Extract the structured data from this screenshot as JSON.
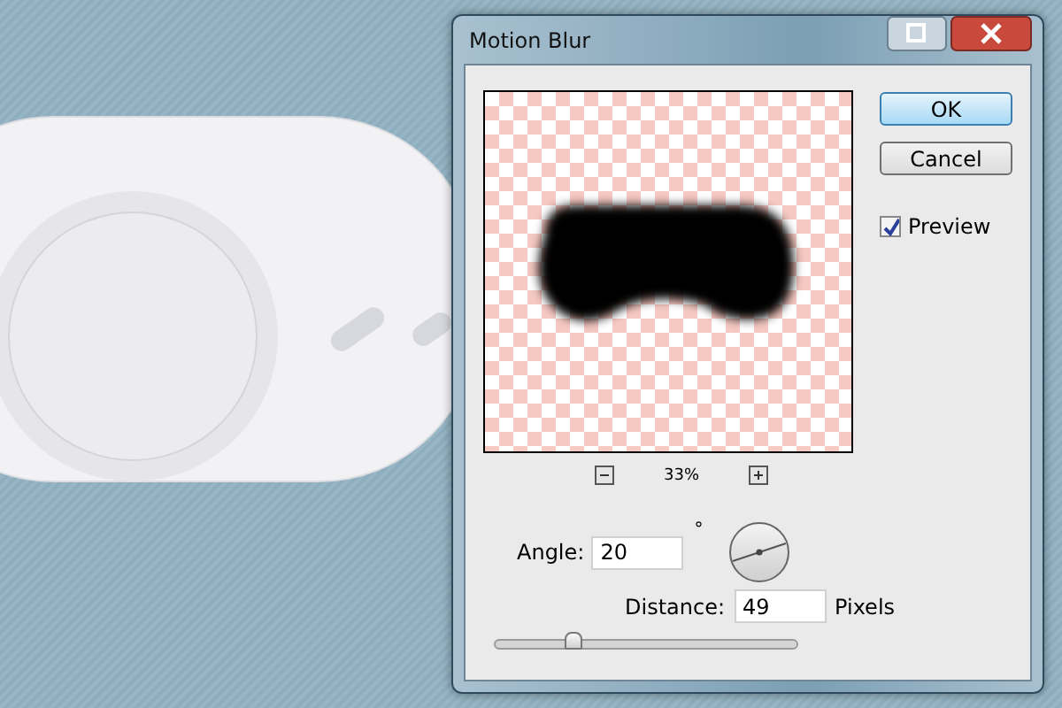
{
  "window": {
    "title": "Motion Blur"
  },
  "buttons": [
    {
      "label": "OK",
      "default": true
    },
    {
      "label": "Cancel",
      "default": false
    }
  ],
  "preview": {
    "label": "Preview",
    "checked": true
  },
  "zoom_level": "33%",
  "angle": {
    "label": "Angle:",
    "value": "20",
    "unit": "°"
  },
  "distance": {
    "label": "Distance:",
    "value": "49",
    "unit": "Pixels",
    "level": 0.26
  }
}
